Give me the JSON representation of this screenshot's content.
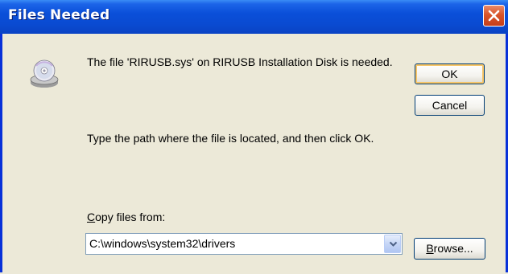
{
  "window": {
    "title": "Files Needed"
  },
  "message": {
    "line1": "The file 'RIRUSB.sys' on RIRUSB Installation Disk is needed.",
    "line2": "Type the path where the file is located, and then click OK."
  },
  "buttons": {
    "ok_label": "OK",
    "cancel_label": "Cancel",
    "browse_label_prefix": "B",
    "browse_label_rest": "rowse..."
  },
  "copy_from": {
    "label_prefix": "C",
    "label_rest": "opy files from:",
    "value": "C:\\windows\\system32\\drivers"
  },
  "icons": {
    "dialog": "disk-icon",
    "close": "close-icon",
    "dropdown": "chevron-down-icon"
  },
  "colors": {
    "titlebar": "#0a4fd9",
    "close_button": "#d9552a",
    "dialog_background": "#ece9d8",
    "default_button_highlight": "#f7c567"
  }
}
